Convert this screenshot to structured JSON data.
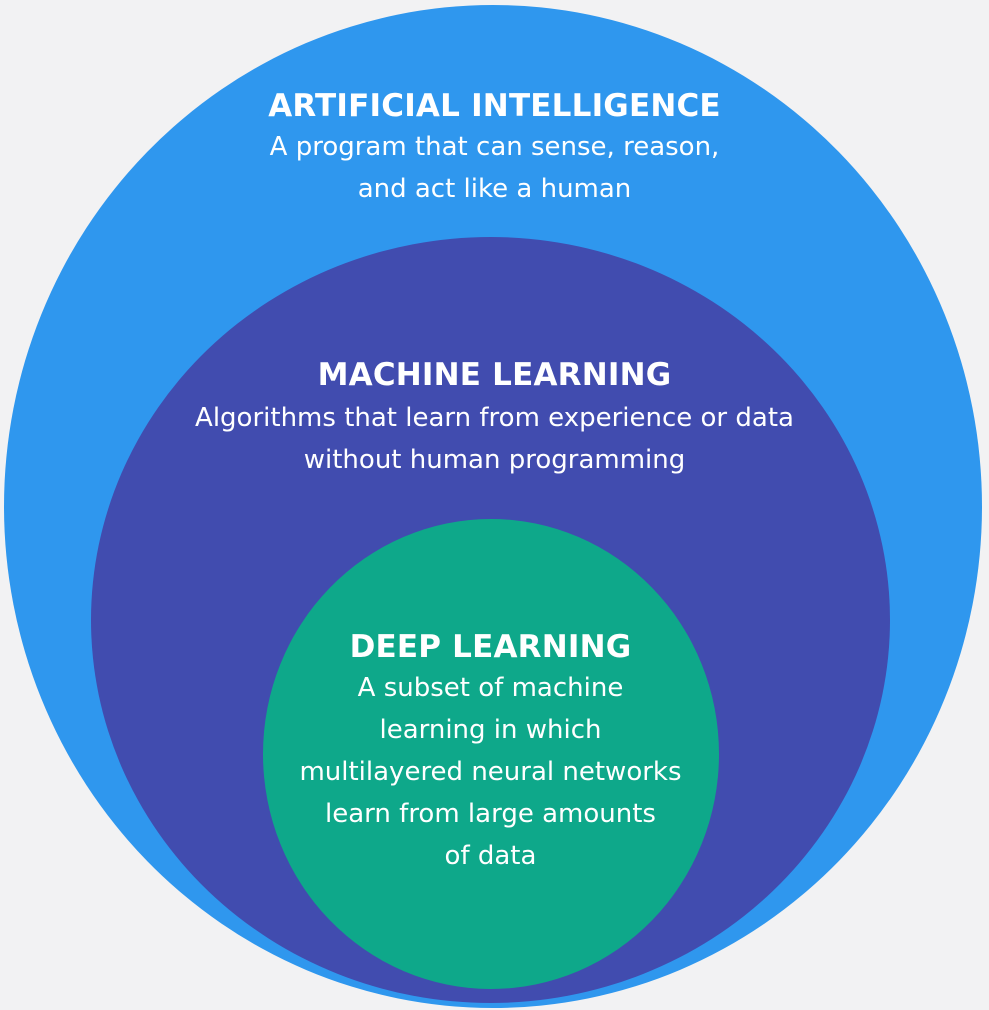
{
  "colors": {
    "background": "#f2f2f3",
    "artificial_intelligence": "#2f97ee",
    "machine_learning": "#414caf",
    "deep_learning": "#0ea88a",
    "text": "#ffffff"
  },
  "artificial_intelligence": {
    "title": "ARTIFICIAL INTELLIGENCE",
    "description": "A program that can sense, reason,\nand act like a human"
  },
  "machine_learning": {
    "title": "MACHINE LEARNING",
    "description": "Algorithms that learn from experience or data\nwithout human programming"
  },
  "deep_learning": {
    "title": "DEEP LEARNING",
    "description": "A subset of machine\nlearning in which\nmultilayered neural networks\nlearn from large amounts\nof data"
  }
}
